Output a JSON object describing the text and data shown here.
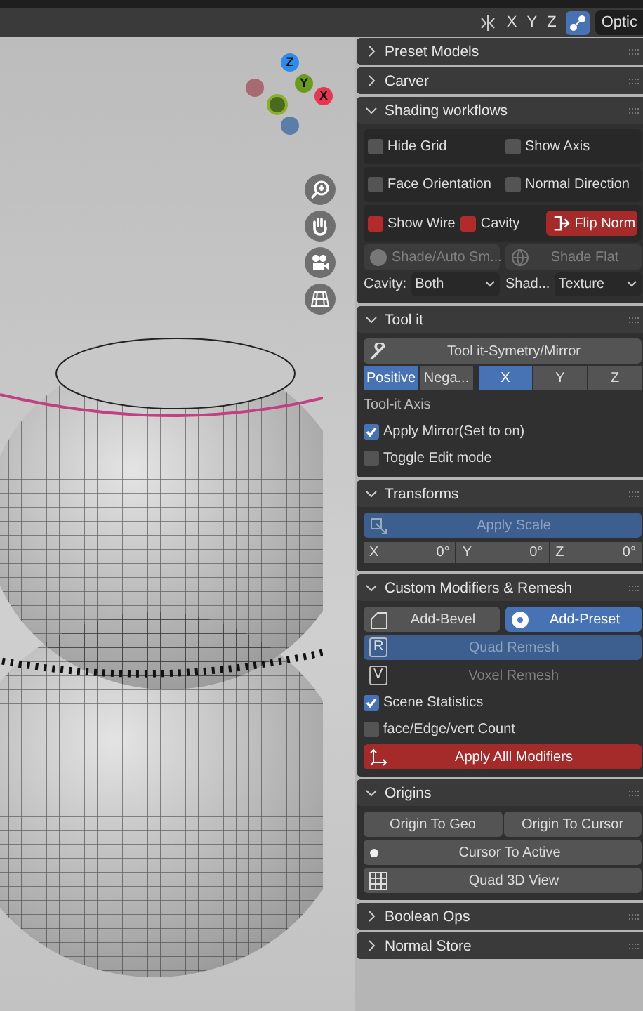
{
  "header": {
    "axes": [
      {
        "label": "X",
        "selected": false
      },
      {
        "label": "Y",
        "selected": false
      },
      {
        "label": "Z",
        "selected": false
      }
    ],
    "options": "Optic"
  },
  "gizmo": {
    "z": "Z",
    "y": "Y",
    "x": "X"
  },
  "panels": [
    {
      "title": "Preset Models",
      "expanded": false
    },
    {
      "title": "Carver",
      "expanded": false
    },
    {
      "title": "Shading workflows",
      "expanded": true,
      "rows": [
        {
          "kind": "box",
          "items": [
            {
              "kind": "check",
              "label": "Hide Grid",
              "checked": false
            },
            {
              "kind": "check",
              "label": "Show Axis",
              "checked": false
            }
          ]
        },
        {
          "kind": "box",
          "items": [
            {
              "kind": "check",
              "label": "Face Orientation",
              "checked": false
            },
            {
              "kind": "check",
              "label": "Normal Direction",
              "checked": false
            }
          ]
        },
        {
          "kind": "box",
          "items": [
            {
              "kind": "redcheck",
              "label": "Show Wire",
              "checked": true
            },
            {
              "kind": "redcheck",
              "label": "Cavity",
              "checked": true
            },
            {
              "kind": "danger-button",
              "label": "Flip Norm",
              "disabled": false
            }
          ]
        },
        {
          "kind": "row",
          "items": [
            {
              "kind": "button",
              "label": "Shade/Auto Sm...",
              "disabled": true
            },
            {
              "kind": "button",
              "label": "Shade Flat",
              "disabled": true
            }
          ]
        },
        {
          "kind": "row",
          "items": [
            {
              "kind": "dropdown",
              "label": "Cavity:",
              "value": "Both"
            },
            {
              "kind": "dropdown",
              "label": "Shad...",
              "value": "Texture"
            }
          ]
        }
      ]
    },
    {
      "title": "Tool it",
      "expanded": true,
      "rows": [
        {
          "kind": "row",
          "items": [
            {
              "kind": "button",
              "label": "Tool it-Symetry/Mirror",
              "disabled": false
            }
          ]
        },
        {
          "kind": "row",
          "items": [
            {
              "kind": "segment",
              "options": [
                {
                  "label": "Positive",
                  "selected": true
                },
                {
                  "label": "Nega...",
                  "selected": false
                }
              ]
            },
            {
              "kind": "segment",
              "options": [
                {
                  "label": "X",
                  "selected": true
                },
                {
                  "label": "Y",
                  "selected": false
                },
                {
                  "label": "Z",
                  "selected": false
                }
              ]
            }
          ]
        },
        {
          "kind": "row",
          "items": [
            {
              "kind": "text",
              "label": "Tool-it Axis"
            }
          ]
        },
        {
          "kind": "row",
          "items": [
            {
              "kind": "check",
              "label": "Apply Mirror(Set to on)",
              "checked": true
            }
          ]
        },
        {
          "kind": "row",
          "items": [
            {
              "kind": "check",
              "label": "Toggle Edit mode",
              "checked": false
            }
          ]
        }
      ]
    },
    {
      "title": "Transforms",
      "expanded": true,
      "rows": [
        {
          "kind": "row",
          "items": [
            {
              "kind": "accent-button",
              "label": "Apply Scale",
              "disabled": true
            }
          ]
        },
        {
          "kind": "row",
          "items": [
            {
              "kind": "fields",
              "fields": [
                {
                  "label": "X",
                  "value": "0°"
                },
                {
                  "label": "Y",
                  "value": "0°"
                },
                {
                  "label": "Z",
                  "value": "0°"
                }
              ]
            }
          ]
        }
      ]
    },
    {
      "title": "Custom Modifiers & Remesh",
      "expanded": true,
      "rows": [
        {
          "kind": "row",
          "items": [
            {
              "kind": "button",
              "label": "Add-Bevel",
              "disabled": false
            },
            {
              "kind": "accent-button",
              "label": "Add-Preset",
              "disabled": false
            }
          ]
        },
        {
          "kind": "row",
          "items": [
            {
              "kind": "accent-button",
              "label": "Quad Remesh",
              "key": "R",
              "disabled": true
            }
          ]
        },
        {
          "kind": "row",
          "items": [
            {
              "kind": "flat-button",
              "label": "Voxel Remesh",
              "key": "V",
              "disabled": true
            }
          ]
        },
        {
          "kind": "row",
          "items": [
            {
              "kind": "check",
              "label": "Scene Statistics",
              "checked": true
            }
          ]
        },
        {
          "kind": "row",
          "items": [
            {
              "kind": "check",
              "label": "face/Edge/vert Count",
              "checked": false
            }
          ]
        },
        {
          "kind": "row",
          "items": [
            {
              "kind": "danger-button",
              "label": "Apply Alll Modifiers",
              "disabled": false
            }
          ]
        }
      ]
    },
    {
      "title": "Origins",
      "expanded": true,
      "rows": [
        {
          "kind": "joined",
          "items": [
            {
              "kind": "button",
              "label": "Origin To Geo",
              "disabled": false
            },
            {
              "kind": "button",
              "label": "Origin To Cursor",
              "disabled": false
            }
          ]
        },
        {
          "kind": "row",
          "items": [
            {
              "kind": "button",
              "label": "Cursor To Active",
              "disabled": false
            }
          ]
        },
        {
          "kind": "row",
          "items": [
            {
              "kind": "button",
              "label": "Quad 3D View",
              "disabled": false
            }
          ]
        }
      ]
    },
    {
      "title": "Boolean Ops",
      "expanded": false
    },
    {
      "title": "Normal Store",
      "expanded": false
    }
  ]
}
